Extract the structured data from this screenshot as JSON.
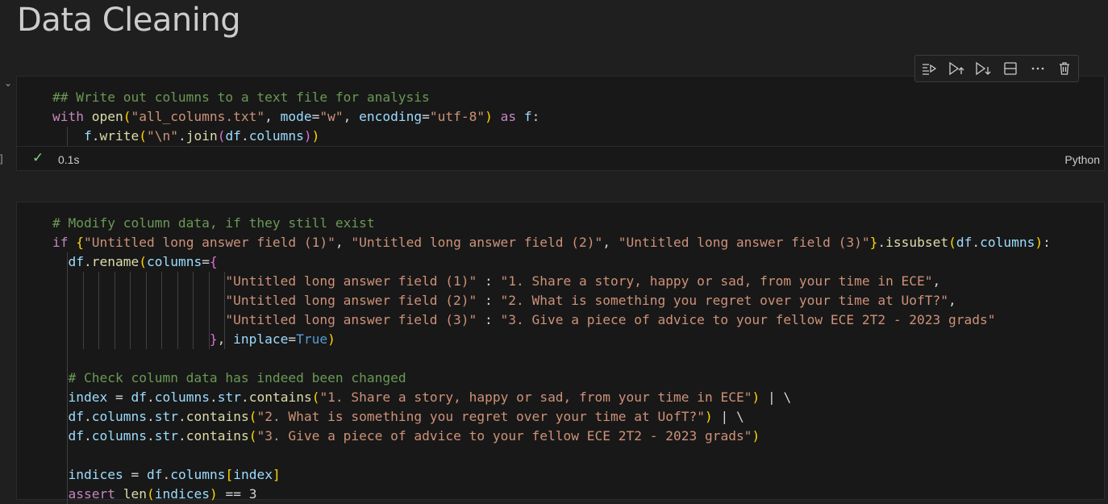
{
  "heading": "Data Cleaning",
  "cell1": {
    "execution_count": "]",
    "status_icon": "check-icon",
    "exec_time": "0.1s",
    "language": "Python",
    "toolbar": [
      {
        "name": "run-by-line-button",
        "icon": "run-by-line-icon"
      },
      {
        "name": "execute-above-button",
        "icon": "execute-above-icon"
      },
      {
        "name": "execute-below-button",
        "icon": "execute-below-icon"
      },
      {
        "name": "split-cell-button",
        "icon": "split-cell-icon"
      },
      {
        "name": "more-actions-button",
        "icon": "more-icon"
      },
      {
        "name": "delete-cell-button",
        "icon": "trash-icon"
      }
    ],
    "lines": [
      [
        {
          "t": "## Write out columns to a text file for analysis",
          "c": "cmt"
        }
      ],
      [
        {
          "t": "with ",
          "c": "ctrl"
        },
        {
          "t": "open",
          "c": "fn"
        },
        {
          "t": "(",
          "c": "br1"
        },
        {
          "t": "\"all_columns.txt\"",
          "c": "str"
        },
        {
          "t": ", ",
          "c": "plain"
        },
        {
          "t": "mode",
          "c": "var"
        },
        {
          "t": "=",
          "c": "plain"
        },
        {
          "t": "\"w\"",
          "c": "str"
        },
        {
          "t": ", ",
          "c": "plain"
        },
        {
          "t": "encoding",
          "c": "var"
        },
        {
          "t": "=",
          "c": "plain"
        },
        {
          "t": "\"utf-8\"",
          "c": "str"
        },
        {
          "t": ")",
          "c": "br1"
        },
        {
          "t": " as ",
          "c": "ctrl"
        },
        {
          "t": "f",
          "c": "var"
        },
        {
          "t": ":",
          "c": "plain"
        }
      ],
      [
        {
          "t": "    ",
          "c": "plain"
        },
        {
          "t": "f",
          "c": "var"
        },
        {
          "t": ".",
          "c": "plain"
        },
        {
          "t": "write",
          "c": "fn"
        },
        {
          "t": "(",
          "c": "br1"
        },
        {
          "t": "\"\\n\"",
          "c": "str"
        },
        {
          "t": ".",
          "c": "plain"
        },
        {
          "t": "join",
          "c": "fn"
        },
        {
          "t": "(",
          "c": "br2"
        },
        {
          "t": "df",
          "c": "var"
        },
        {
          "t": ".",
          "c": "plain"
        },
        {
          "t": "columns",
          "c": "var"
        },
        {
          "t": ")",
          "c": "br2"
        },
        {
          "t": ")",
          "c": "br1"
        }
      ]
    ]
  },
  "cell2": {
    "lines": [
      [
        {
          "t": "# Modify column data, if they still exist",
          "c": "cmt"
        }
      ],
      [
        {
          "t": "if ",
          "c": "ctrl"
        },
        {
          "t": "{",
          "c": "br1"
        },
        {
          "t": "\"Untitled long answer field (1)\"",
          "c": "str"
        },
        {
          "t": ", ",
          "c": "plain"
        },
        {
          "t": "\"Untitled long answer field (2)\"",
          "c": "str"
        },
        {
          "t": ", ",
          "c": "plain"
        },
        {
          "t": "\"Untitled long answer field (3)\"",
          "c": "str"
        },
        {
          "t": "}",
          "c": "br1"
        },
        {
          "t": ".",
          "c": "plain"
        },
        {
          "t": "issubset",
          "c": "fn"
        },
        {
          "t": "(",
          "c": "br1"
        },
        {
          "t": "df",
          "c": "var"
        },
        {
          "t": ".",
          "c": "plain"
        },
        {
          "t": "columns",
          "c": "var"
        },
        {
          "t": ")",
          "c": "br1"
        },
        {
          "t": ":",
          "c": "plain"
        }
      ],
      [
        {
          "t": "  ",
          "c": "plain"
        },
        {
          "t": "df",
          "c": "var"
        },
        {
          "t": ".",
          "c": "plain"
        },
        {
          "t": "rename",
          "c": "fn"
        },
        {
          "t": "(",
          "c": "br1"
        },
        {
          "t": "columns",
          "c": "var"
        },
        {
          "t": "=",
          "c": "plain"
        },
        {
          "t": "{",
          "c": "br2"
        }
      ],
      [
        {
          "t": "                      ",
          "c": "plain"
        },
        {
          "t": "\"Untitled long answer field (1)\"",
          "c": "str"
        },
        {
          "t": " : ",
          "c": "plain"
        },
        {
          "t": "\"1. Share a story, happy or sad, from your time in ECE\"",
          "c": "str"
        },
        {
          "t": ",",
          "c": "plain"
        }
      ],
      [
        {
          "t": "                      ",
          "c": "plain"
        },
        {
          "t": "\"Untitled long answer field (2)\"",
          "c": "str"
        },
        {
          "t": " : ",
          "c": "plain"
        },
        {
          "t": "\"2. What is something you regret over your time at UofT?\"",
          "c": "str"
        },
        {
          "t": ",",
          "c": "plain"
        }
      ],
      [
        {
          "t": "                      ",
          "c": "plain"
        },
        {
          "t": "\"Untitled long answer field (3)\"",
          "c": "str"
        },
        {
          "t": " : ",
          "c": "plain"
        },
        {
          "t": "\"3. Give a piece of advice to your fellow ECE 2T2 - 2023 grads\"",
          "c": "str"
        }
      ],
      [
        {
          "t": "                    ",
          "c": "plain"
        },
        {
          "t": "}",
          "c": "br2"
        },
        {
          "t": ", ",
          "c": "plain"
        },
        {
          "t": "inplace",
          "c": "var"
        },
        {
          "t": "=",
          "c": "plain"
        },
        {
          "t": "True",
          "c": "kw"
        },
        {
          "t": ")",
          "c": "br1"
        }
      ],
      [
        {
          "t": "",
          "c": "plain"
        }
      ],
      [
        {
          "t": "  ",
          "c": "plain"
        },
        {
          "t": "# Check column data has indeed been changed",
          "c": "cmt"
        }
      ],
      [
        {
          "t": "  ",
          "c": "plain"
        },
        {
          "t": "index",
          "c": "var"
        },
        {
          "t": " = ",
          "c": "plain"
        },
        {
          "t": "df",
          "c": "var"
        },
        {
          "t": ".",
          "c": "plain"
        },
        {
          "t": "columns",
          "c": "var"
        },
        {
          "t": ".",
          "c": "plain"
        },
        {
          "t": "str",
          "c": "var"
        },
        {
          "t": ".",
          "c": "plain"
        },
        {
          "t": "contains",
          "c": "fn"
        },
        {
          "t": "(",
          "c": "br1"
        },
        {
          "t": "\"1. Share a story, happy or sad, from your time in ECE\"",
          "c": "str"
        },
        {
          "t": ")",
          "c": "br1"
        },
        {
          "t": " | \\",
          "c": "plain"
        }
      ],
      [
        {
          "t": "  ",
          "c": "plain"
        },
        {
          "t": "df",
          "c": "var"
        },
        {
          "t": ".",
          "c": "plain"
        },
        {
          "t": "columns",
          "c": "var"
        },
        {
          "t": ".",
          "c": "plain"
        },
        {
          "t": "str",
          "c": "var"
        },
        {
          "t": ".",
          "c": "plain"
        },
        {
          "t": "contains",
          "c": "fn"
        },
        {
          "t": "(",
          "c": "br1"
        },
        {
          "t": "\"2. What is something you regret over your time at UofT?\"",
          "c": "str"
        },
        {
          "t": ")",
          "c": "br1"
        },
        {
          "t": " | \\",
          "c": "plain"
        }
      ],
      [
        {
          "t": "  ",
          "c": "plain"
        },
        {
          "t": "df",
          "c": "var"
        },
        {
          "t": ".",
          "c": "plain"
        },
        {
          "t": "columns",
          "c": "var"
        },
        {
          "t": ".",
          "c": "plain"
        },
        {
          "t": "str",
          "c": "var"
        },
        {
          "t": ".",
          "c": "plain"
        },
        {
          "t": "contains",
          "c": "fn"
        },
        {
          "t": "(",
          "c": "br1"
        },
        {
          "t": "\"3. Give a piece of advice to your fellow ECE 2T2 - 2023 grads\"",
          "c": "str"
        },
        {
          "t": ")",
          "c": "br1"
        }
      ],
      [
        {
          "t": "",
          "c": "plain"
        }
      ],
      [
        {
          "t": "  ",
          "c": "plain"
        },
        {
          "t": "indices",
          "c": "var"
        },
        {
          "t": " = ",
          "c": "plain"
        },
        {
          "t": "df",
          "c": "var"
        },
        {
          "t": ".",
          "c": "plain"
        },
        {
          "t": "columns",
          "c": "var"
        },
        {
          "t": "[",
          "c": "br1"
        },
        {
          "t": "index",
          "c": "var"
        },
        {
          "t": "]",
          "c": "br1"
        }
      ],
      [
        {
          "t": "  ",
          "c": "plain"
        },
        {
          "t": "assert ",
          "c": "ctrl"
        },
        {
          "t": "len",
          "c": "fn"
        },
        {
          "t": "(",
          "c": "br1"
        },
        {
          "t": "indices",
          "c": "var"
        },
        {
          "t": ")",
          "c": "br1"
        },
        {
          "t": " == ",
          "c": "plain"
        },
        {
          "t": "3",
          "c": "plain"
        }
      ]
    ]
  }
}
